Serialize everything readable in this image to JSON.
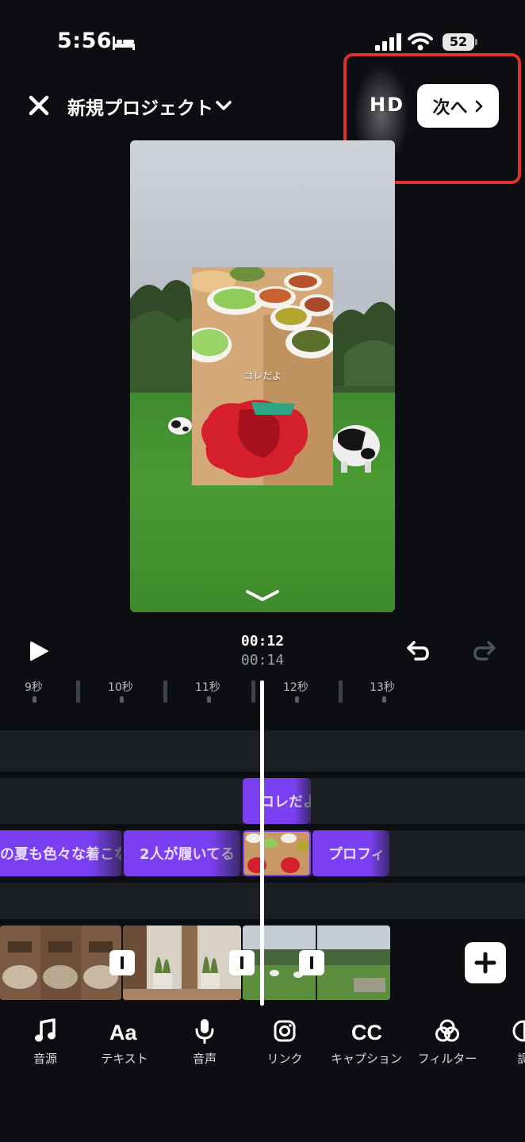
{
  "status_bar": {
    "time": "5:56",
    "battery": "52"
  },
  "header": {
    "title": "新規プロジェクト",
    "quality": "HD",
    "next_label": "次へ"
  },
  "preview": {
    "overlay_caption": "コレだよ"
  },
  "playback": {
    "current_time": "00:12",
    "total_time": "00:14"
  },
  "ruler": {
    "labels": [
      "9秒",
      "10秒",
      "11秒",
      "12秒",
      "13秒"
    ]
  },
  "timeline": {
    "text_clip_top": "コレだよ",
    "text_clips": [
      "の夏も色々な着こな",
      "2人が履いてる",
      "プロフィ"
    ]
  },
  "toolbar": {
    "items": [
      {
        "label": "音源",
        "icon": "music-note-icon"
      },
      {
        "label": "テキスト",
        "icon": "text-aa-icon"
      },
      {
        "label": "音声",
        "icon": "microphone-icon"
      },
      {
        "label": "リンク",
        "icon": "instagram-icon"
      },
      {
        "label": "キャプション",
        "icon": "cc-icon"
      },
      {
        "label": "フィルター",
        "icon": "filter-icon"
      },
      {
        "label": "調",
        "icon": "adjust-icon"
      }
    ]
  },
  "colors": {
    "background": "#0c0e12",
    "accent_purple": "#7b3ff2",
    "highlight_red": "#e0302b"
  }
}
